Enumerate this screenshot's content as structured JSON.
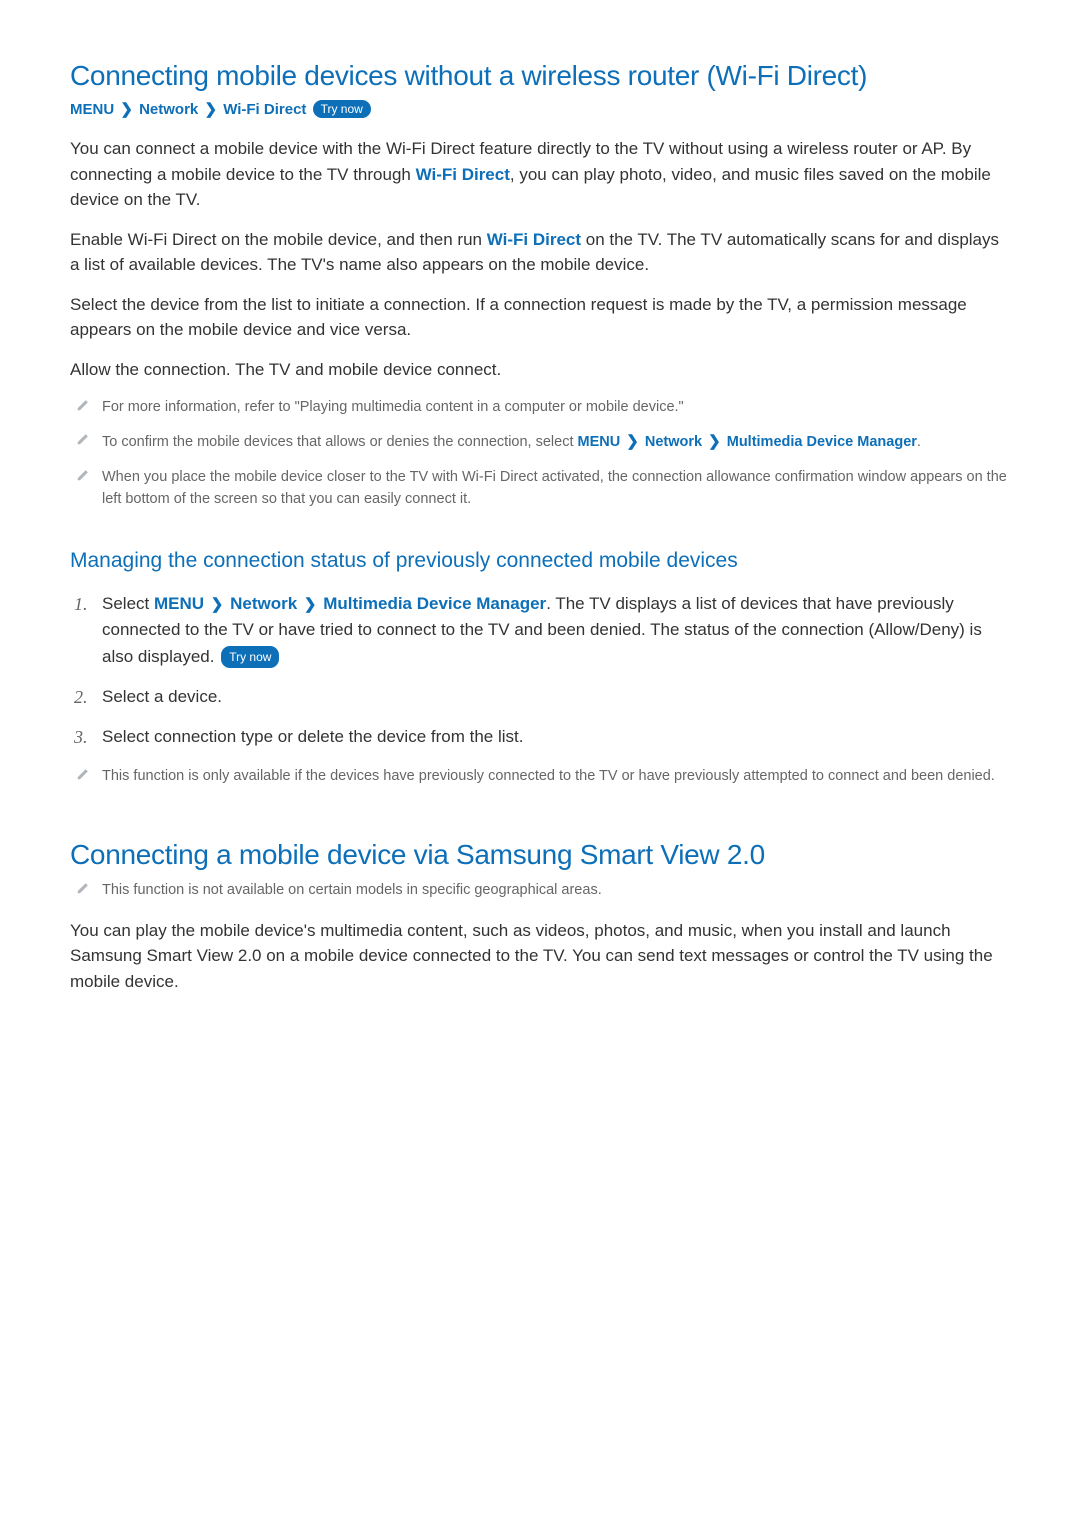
{
  "section1": {
    "title": "Connecting mobile devices without a wireless router (Wi-Fi Direct)",
    "breadcrumb": {
      "menu": "MENU",
      "network": "Network",
      "wifi_direct": "Wi-Fi Direct",
      "try_now": "Try now"
    },
    "p1_a": "You can connect a mobile device with the Wi-Fi Direct feature directly to the TV without using a wireless router or AP. By connecting a mobile device to the TV through ",
    "p1_accent": "Wi-Fi Direct",
    "p1_b": ", you can play photo, video, and music files saved on the mobile device on the TV.",
    "p2_a": "Enable Wi-Fi Direct on the mobile device, and then run ",
    "p2_accent": "Wi-Fi Direct",
    "p2_b": " on the TV. The TV automatically scans for and displays a list of available devices. The TV's name also appears on the mobile device.",
    "p3": "Select the device from the list to initiate a connection. If a connection request is made by the TV, a permission message appears on the mobile device and vice versa.",
    "p4": "Allow the connection. The TV and mobile device connect.",
    "notes": {
      "n1": "For more information, refer to \"Playing multimedia content in a computer or mobile device.\"",
      "n2_a": "To confirm the mobile devices that allows or denies the connection, select ",
      "n2_menu": "MENU",
      "n2_network": "Network",
      "n2_mdm": "Multimedia Device Manager",
      "n2_end": ".",
      "n3": "When you place the mobile device closer to the TV with Wi-Fi Direct activated, the connection allowance confirmation window appears on the left bottom of the screen so that you can easily connect it."
    }
  },
  "subsection": {
    "title": "Managing the connection status of previously connected mobile devices",
    "step1_a": "Select ",
    "step1_menu": "MENU",
    "step1_network": "Network",
    "step1_mdm": "Multimedia Device Manager",
    "step1_b": ". The TV displays a list of devices that have previously connected to the TV or have tried to connect to the TV and been denied. The status of the connection (Allow/Deny) is also displayed. ",
    "step1_try_now": "Try now",
    "step2": "Select a device.",
    "step3": "Select connection type or delete the device from the list.",
    "note": "This function is only available if the devices have previously connected to the TV or have previously attempted to connect and been denied."
  },
  "section2": {
    "title": "Connecting a mobile device via Samsung Smart View 2.0",
    "note": "This function is not available on certain models in specific geographical areas.",
    "p1": "You can play the mobile device's multimedia content, such as videos, photos, and music, when you install and launch Samsung Smart View 2.0 on a mobile device connected to the TV. You can send text messages or control the TV using the mobile device."
  },
  "icons": {
    "chevron": "❯"
  }
}
